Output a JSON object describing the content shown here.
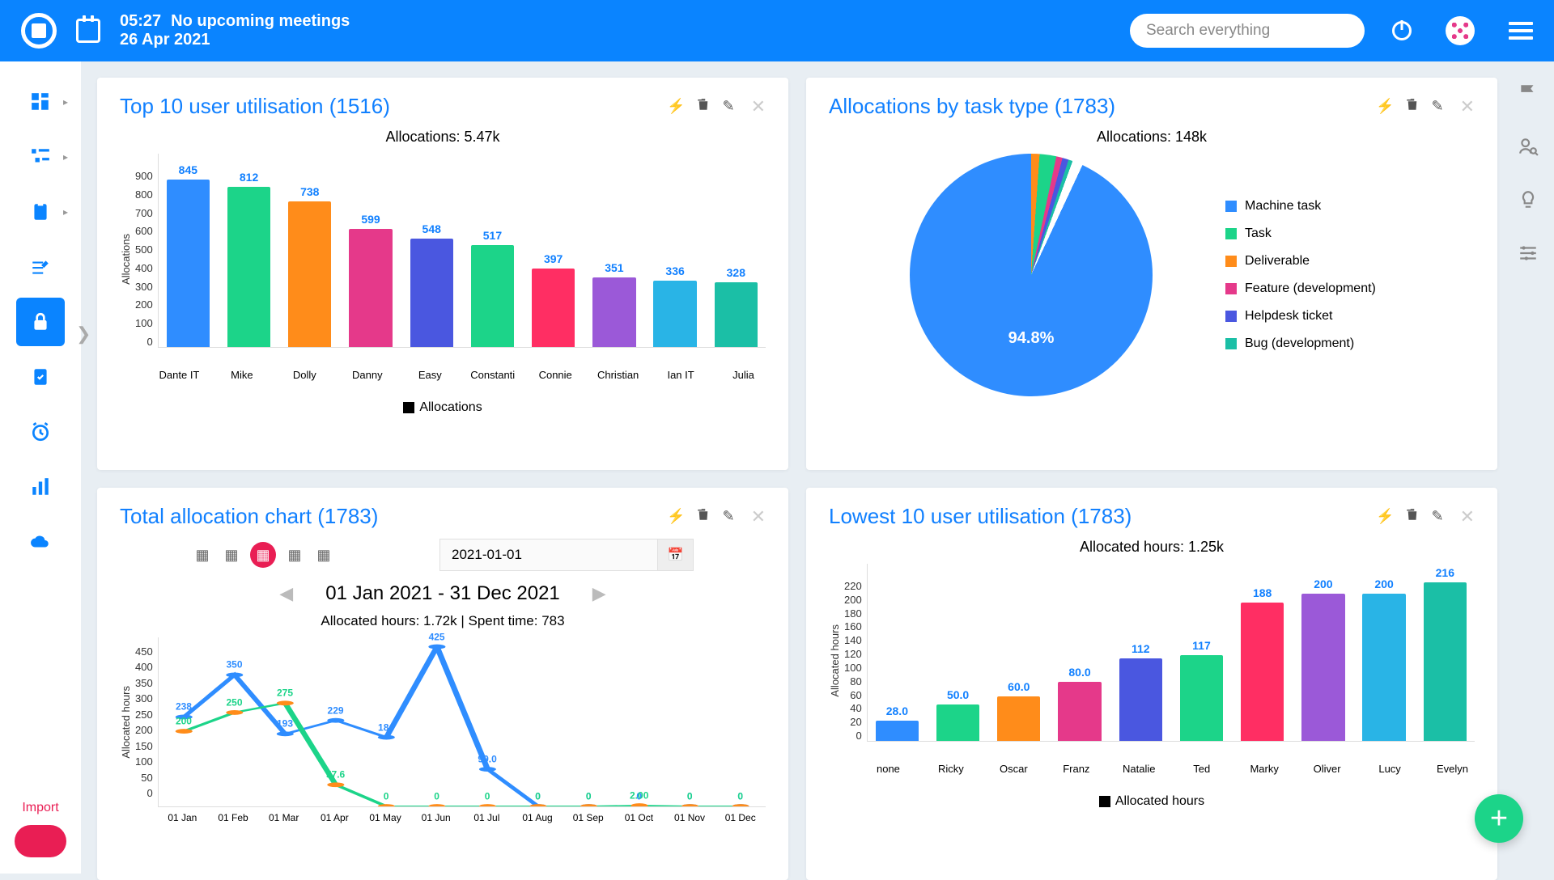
{
  "header": {
    "time": "05:27",
    "meeting_status": "No upcoming meetings",
    "date": "26 Apr 2021",
    "search_placeholder": "Search everything"
  },
  "leftnav_import": "Import",
  "panel1": {
    "title": "Top 10 user utilisation (1516)",
    "subtitle": "Allocations: 5.47k",
    "ylabel": "Allocations",
    "legend": "Allocations"
  },
  "panel2": {
    "title": "Allocations by task type (1783)",
    "subtitle": "Allocations: 148k",
    "main_pct": "94.8%",
    "legend": [
      "Machine task",
      "Task",
      "Deliverable",
      "Feature (development)",
      "Helpdesk ticket",
      "Bug (development)"
    ]
  },
  "panel3": {
    "title": "Total allocation chart (1783)",
    "date_value": "2021-01-01",
    "range": "01 Jan 2021 - 31 Dec 2021",
    "range_sub": "Allocated hours: 1.72k | Spent time: 783",
    "ylabel": "Allocated hours"
  },
  "panel4": {
    "title": "Lowest 10 user utilisation (1783)",
    "subtitle": "Allocated hours: 1.25k",
    "ylabel": "Allocated hours",
    "legend": "Allocated hours"
  },
  "chart_data": [
    {
      "type": "bar",
      "title": "Top 10 user utilisation (1516) — Allocations: 5.47k",
      "ylabel": "Allocations",
      "ylim": [
        0,
        900
      ],
      "categories": [
        "Dante IT",
        "Mike",
        "Dolly",
        "Danny",
        "Easy",
        "Constanti",
        "Connie",
        "Christian",
        "Ian IT",
        "Julia"
      ],
      "values": [
        845,
        812,
        738,
        599,
        548,
        517,
        397,
        351,
        336,
        328
      ],
      "colors": [
        "#2f8dff",
        "#1cd489",
        "#ff8c1a",
        "#e5398a",
        "#4a57e0",
        "#1cd489",
        "#ff2e63",
        "#9b59d8",
        "#29b4e6",
        "#1bbfa6"
      ]
    },
    {
      "type": "pie",
      "title": "Allocations by task type (1783) — Allocations: 148k",
      "series": [
        {
          "name": "Machine task",
          "value": 94.8,
          "color": "#2f8dff"
        },
        {
          "name": "Task",
          "value": 2.0,
          "color": "#1cd489"
        },
        {
          "name": "Deliverable",
          "value": 1.0,
          "color": "#ff8c1a"
        },
        {
          "name": "Feature (development)",
          "value": 0.8,
          "color": "#e5398a"
        },
        {
          "name": "Helpdesk ticket",
          "value": 0.7,
          "color": "#4a57e0"
        },
        {
          "name": "Bug (development)",
          "value": 0.7,
          "color": "#1bbfa6"
        }
      ]
    },
    {
      "type": "line",
      "title": "Total allocation chart (1783)",
      "xlabel": "",
      "ylabel": "Allocated hours",
      "ylim": [
        0,
        450
      ],
      "x": [
        "01 Jan",
        "01 Feb",
        "01 Mar",
        "01 Apr",
        "01 May",
        "01 Jun",
        "01 Jul",
        "01 Aug",
        "01 Sep",
        "01 Oct",
        "01 Nov",
        "01 Dec"
      ],
      "series": [
        {
          "name": "Allocated hours",
          "color": "#2f8dff",
          "values": [
            238,
            350,
            193,
            229,
            184,
            425,
            99.0,
            0,
            0,
            0,
            0,
            0
          ],
          "labels": [
            "238",
            "350",
            "193",
            "229",
            "184",
            "425",
            "99.0",
            "0",
            "0",
            "0",
            "0",
            "0"
          ]
        },
        {
          "name": "Spent time",
          "color": "#1cd489",
          "values": [
            200,
            250,
            275,
            57.6,
            0,
            0,
            0,
            0,
            0,
            2.0,
            0,
            0
          ],
          "labels": [
            "200",
            "250",
            "275",
            "57.6",
            "0",
            "0",
            "0",
            "0",
            "0",
            "2.00",
            "0",
            "0"
          ],
          "marker_color": "#ff8c1a"
        }
      ]
    },
    {
      "type": "bar",
      "title": "Lowest 10 user utilisation (1783) — Allocated hours: 1.25k",
      "ylabel": "Allocated hours",
      "ylim": [
        0,
        220
      ],
      "categories": [
        "none",
        "Ricky",
        "Oscar",
        "Franz",
        "Natalie",
        "Ted",
        "Marky",
        "Oliver",
        "Lucy",
        "Evelyn"
      ],
      "values": [
        28.0,
        50.0,
        60.0,
        80.0,
        112,
        117,
        188,
        200,
        200,
        216
      ],
      "labels": [
        "28.0",
        "50.0",
        "60.0",
        "80.0",
        "112",
        "117",
        "188",
        "200",
        "200",
        "216"
      ],
      "colors": [
        "#2f8dff",
        "#1cd489",
        "#ff8c1a",
        "#e5398a",
        "#4a57e0",
        "#1cd489",
        "#ff2e63",
        "#9b59d8",
        "#29b4e6",
        "#1bbfa6"
      ]
    }
  ]
}
